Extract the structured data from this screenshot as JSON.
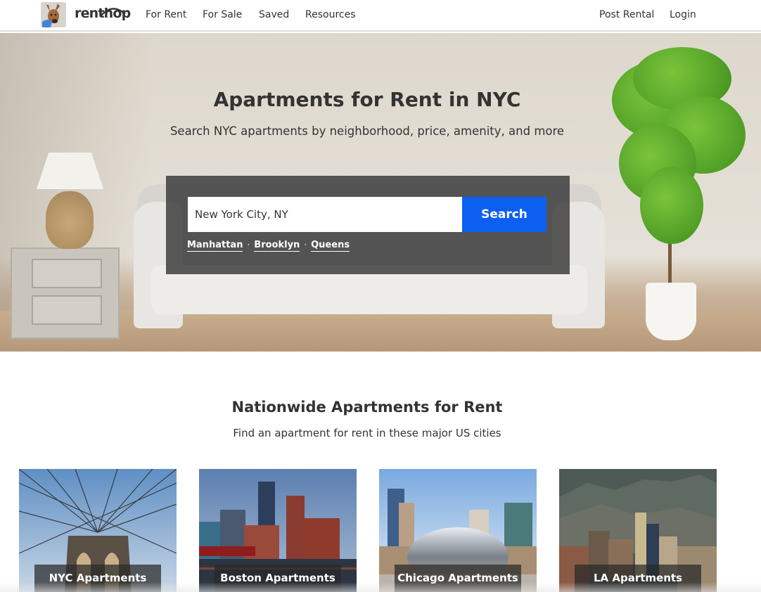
{
  "nav": {
    "brand": "renthop",
    "links": [
      "For Rent",
      "For Sale",
      "Saved",
      "Resources"
    ],
    "right_links": [
      "Post Rental",
      "Login"
    ]
  },
  "hero": {
    "title": "Apartments for Rent in NYC",
    "subtitle": "Search NYC apartments by neighborhood, price, amenity, and more",
    "search": {
      "value": "New York City, NY",
      "button_label": "Search",
      "button_color": "#0d5ff2"
    },
    "quick_links": [
      "Manhattan",
      "Brooklyn",
      "Queens"
    ],
    "separator": "·"
  },
  "nationwide": {
    "title": "Nationwide Apartments for Rent",
    "subtitle": "Find an apartment for rent in these major US cities",
    "cities": [
      {
        "label": "NYC Apartments",
        "image": "brooklyn-bridge"
      },
      {
        "label": "Boston Apartments",
        "image": "boston-skyline"
      },
      {
        "label": "Chicago Apartments",
        "image": "chicago-bean"
      },
      {
        "label": "LA Apartments",
        "image": "la-skyline"
      }
    ]
  }
}
